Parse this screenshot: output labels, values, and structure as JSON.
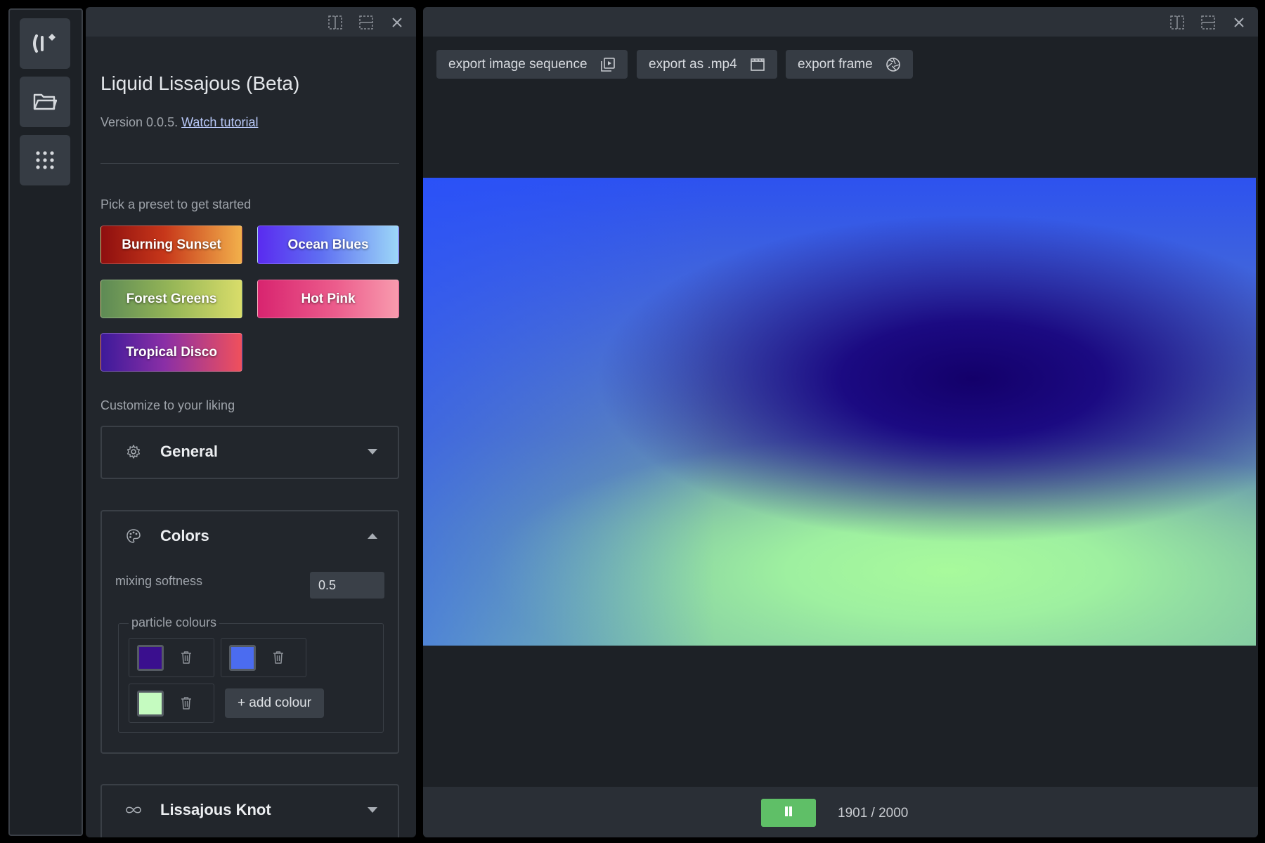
{
  "rail": {
    "items": [
      {
        "name": "logo-icon"
      },
      {
        "name": "folder-icon"
      },
      {
        "name": "grid-icon"
      }
    ]
  },
  "panel": {
    "title": "Liquid Lissajous (Beta)",
    "version_prefix": "Version 0.0.5.",
    "tutorial_link": "Watch tutorial",
    "preset_prompt": "Pick a preset to get started",
    "presets": [
      {
        "label": "Burning Sunset"
      },
      {
        "label": "Ocean Blues"
      },
      {
        "label": "Forest Greens"
      },
      {
        "label": "Hot Pink"
      },
      {
        "label": "Tropical Disco"
      }
    ],
    "customize_prompt": "Customize to your liking",
    "sections": {
      "general": {
        "title": "General",
        "icon": "gear-icon",
        "expanded": false
      },
      "colors": {
        "title": "Colors",
        "icon": "palette-icon",
        "expanded": true,
        "mixing_label": "mixing softness",
        "mixing_value": "0.5",
        "particle_legend": "particle colours",
        "particle_colours": [
          "#3a0f8e",
          "#4b6cf0",
          "#c5fbc0"
        ],
        "add_label": "+ add colour"
      },
      "lissajous": {
        "title": "Lissajous Knot",
        "icon": "infinity-icon",
        "expanded": false
      }
    }
  },
  "viewer": {
    "exports": [
      {
        "label": "export image sequence",
        "icon": "image-sequence-icon"
      },
      {
        "label": "export as .mp4",
        "icon": "clapper-icon"
      },
      {
        "label": "export frame",
        "icon": "aperture-icon"
      }
    ],
    "frame_count": "1901 / 2000",
    "play_state": "pause",
    "accent": "#5fbf67"
  }
}
